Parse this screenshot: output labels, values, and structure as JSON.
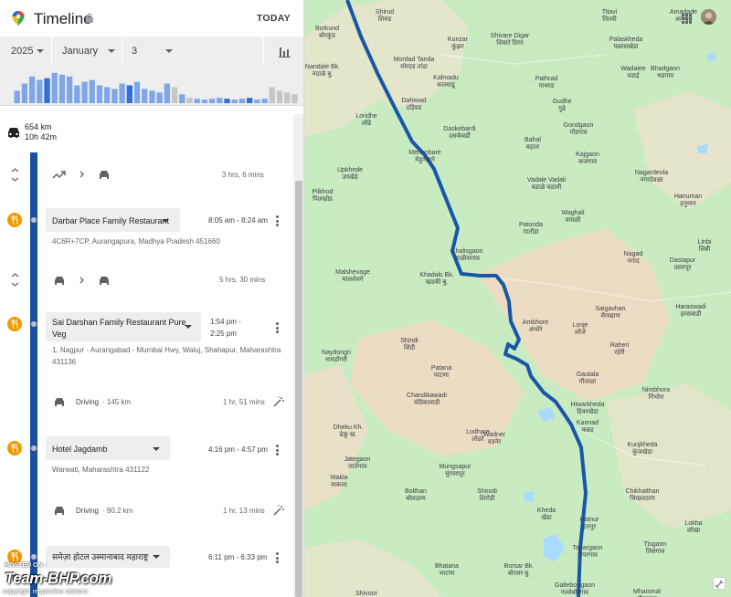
{
  "header": {
    "title": "Timeline",
    "today_label": "TODAY"
  },
  "date_picker": {
    "year": "2025",
    "month": "January",
    "day": "3"
  },
  "summary": {
    "distance": "654 km",
    "duration": "10h 42m"
  },
  "entries": {
    "move1": {
      "duration": "3 hrs, 6 mins"
    },
    "visit1": {
      "name": "Darbar Place Family Restaurant",
      "time": "8:05 am - 8:24 am",
      "address": "4C6R+7CP, Aurangapura, Madhya Pradesh 451660"
    },
    "move2": {
      "duration": "5 hrs, 30 mins"
    },
    "visit2": {
      "name_line1": "Sai Darshan Family Restaurant Pure",
      "name_line2": "Veg",
      "time_line1": "1:54 pm -",
      "time_line2": "2:25 pm",
      "address_line1": "1, Nagpur - Aurangabad - Mumbai Hwy, Waluj, Shahapur, Maharashtra",
      "address_line2": "431136"
    },
    "drive1": {
      "mode": "Driving",
      "distance": "· 145 km",
      "duration": "1 hr, 51 mins"
    },
    "visit3": {
      "name": "Hotel Jagdamb",
      "time": "4:16 pm - 4:57 pm",
      "address": "Warwati, Maharashtra 431122"
    },
    "drive2": {
      "mode": "Driving",
      "distance": "· 90.2 km",
      "duration": "1 hr, 13 mins"
    },
    "visit4": {
      "name": "समेज़ा होटल उस्मानाबाद महाराष्ट्र",
      "time": "6:11 pm - 6:33 pm"
    }
  },
  "map_labels": [
    {
      "name": "Shirud",
      "local": "शिरुड"
    },
    {
      "name": "Borkund",
      "local": "बोरकुंड"
    },
    {
      "name": "Titavi",
      "local": "तितवी"
    },
    {
      "name": "Amadade",
      "local": "आमदडे"
    },
    {
      "name": "Palaskheda",
      "local": "पळासखेडा"
    },
    {
      "name": "Kunzar",
      "local": "कुंझर"
    },
    {
      "name": "Shivare Digar",
      "local": "शिवारे दिगर"
    },
    {
      "name": "Nandale Bk.",
      "local": "नंदाळे बु."
    },
    {
      "name": "Mordad Tanda",
      "local": "मोरदड तांडा"
    },
    {
      "name": "Wadaiee",
      "local": "वडाई"
    },
    {
      "name": "Bhadgaon",
      "local": "भडगाव"
    },
    {
      "name": "Kalmadu",
      "local": "कलमाडू"
    },
    {
      "name": "Pathrad",
      "local": "पाथरड"
    },
    {
      "name": "Dahiwad",
      "local": "दहिवड"
    },
    {
      "name": "Londhe",
      "local": "लोंढे"
    },
    {
      "name": "Gudhe",
      "local": "गुढे"
    },
    {
      "name": "Gondgaon",
      "local": "गोंडगाव"
    },
    {
      "name": "Daskebardi",
      "local": "दसकेबर्डी"
    },
    {
      "name": "Bahal",
      "local": "बहाल"
    },
    {
      "name": "Mehunbare",
      "local": "मेहुणबारे"
    },
    {
      "name": "Kajgaon",
      "local": "कजगाव"
    },
    {
      "name": "Upkhede",
      "local": "उपखेडे"
    },
    {
      "name": "Nagardeola",
      "local": "नगरदेवळा"
    },
    {
      "name": "Vadale Vadali",
      "local": "वडाळे वडाली"
    },
    {
      "name": "Hanuman",
      "local": "हनुमान"
    },
    {
      "name": "Pilkhod",
      "local": "पिलखोड"
    },
    {
      "name": "Waghali",
      "local": "वाघळी"
    },
    {
      "name": "Patonda",
      "local": "पातोंडा"
    },
    {
      "name": "Nagad",
      "local": "नगाद"
    },
    {
      "name": "Linbi",
      "local": "लिंबी"
    },
    {
      "name": "Chalisgaon",
      "local": "चाळीसगाव"
    },
    {
      "name": "Dastapur",
      "local": "दस्तापूर"
    },
    {
      "name": "Malshevage",
      "local": "मालशेवगे"
    },
    {
      "name": "Khadaki Bk.",
      "local": "खडकी बु."
    },
    {
      "name": "Saigavhan",
      "local": "सैगव्हाण"
    },
    {
      "name": "Haraswadi",
      "local": "हरसवाडी"
    },
    {
      "name": "Ambhore",
      "local": "अंभोरे"
    },
    {
      "name": "Lonje",
      "local": "लोंजे"
    },
    {
      "name": "Raheri",
      "local": "रहेरी"
    },
    {
      "name": "Shindi",
      "local": "शिंदी"
    },
    {
      "name": "Naydongri",
      "local": "नायडोंगरी"
    },
    {
      "name": "Patana",
      "local": "पाटणा"
    },
    {
      "name": "Gautala",
      "local": "गौताळा"
    },
    {
      "name": "Chandikawadi",
      "local": "चंडिकावाडी"
    },
    {
      "name": "Nimbhora",
      "local": "निंभोरा"
    },
    {
      "name": "Hiwarkheda",
      "local": "हिवरखेडा"
    },
    {
      "name": "Kannad",
      "local": "कन्नड"
    },
    {
      "name": "Dheku Kh.",
      "local": "ढेकू ख."
    },
    {
      "name": "Lodhare",
      "local": "लोढरे"
    },
    {
      "name": "Wadner",
      "local": "वडनेर"
    },
    {
      "name": "Kunjkheda",
      "local": "कुंजखेडा"
    },
    {
      "name": "Jategaon",
      "local": "जातेगाव"
    },
    {
      "name": "Mungsapur",
      "local": "मुंगसापूर"
    },
    {
      "name": "Wakla",
      "local": "वाकला"
    },
    {
      "name": "Bolthan",
      "local": "बोलठाण"
    },
    {
      "name": "Shirodi",
      "local": "शिरोडी"
    },
    {
      "name": "Chikhalthan",
      "local": "चिखलठाण"
    },
    {
      "name": "Kheda",
      "local": "खेडा"
    },
    {
      "name": "Hatnur",
      "local": "हतनूर"
    },
    {
      "name": "Lokha",
      "local": "लोखा"
    },
    {
      "name": "Tisgaon",
      "local": "तिसगाव"
    },
    {
      "name": "Tapargaon",
      "local": "टापरगाव"
    },
    {
      "name": "Bhatana",
      "local": "भाटणा"
    },
    {
      "name": "Borsar Bk.",
      "local": "बोरसर बु."
    },
    {
      "name": "Gallebo rgaon",
      "local": "गल्लेबोरगाव"
    },
    {
      "name": "Mhaismal",
      "local": "म्हैसमाळ"
    },
    {
      "name": "Shivoor",
      "local": "शिवूर"
    }
  ],
  "watermark": {
    "hosted": "HOSTED ON :",
    "brand": "Team-BHP.com",
    "copyright": "copyright respective owners"
  },
  "colors": {
    "route": "#1a56a8",
    "timeline_bar": "#1a4fa0",
    "restaurant_icon": "#f29900",
    "map_green": "#c8ebc1",
    "map_tan": "#ecdcc4"
  }
}
